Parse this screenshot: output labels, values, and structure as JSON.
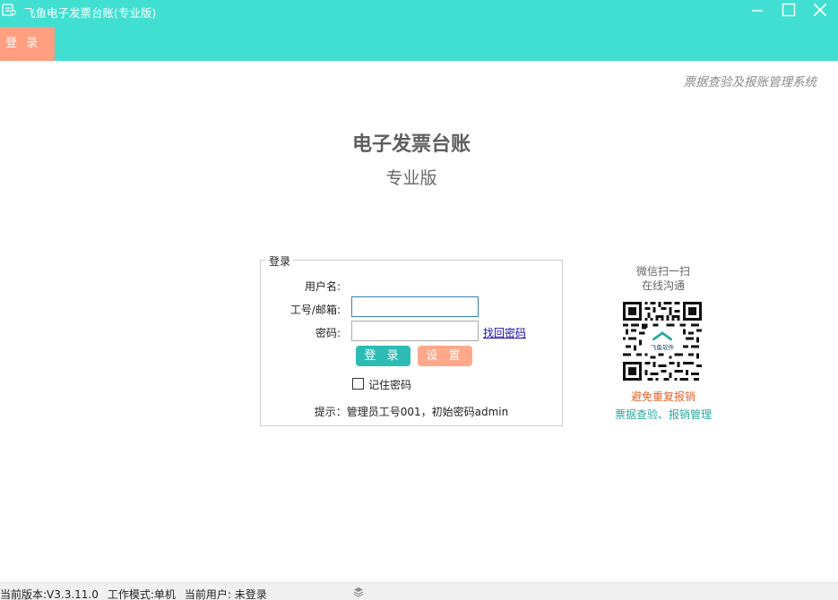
{
  "window": {
    "title": "飞鱼电子发票台账(专业版)",
    "controls": {
      "minimize_icon": "minimize-icon",
      "maximize_icon": "maximize-icon",
      "close_icon": "close-icon"
    }
  },
  "nav": {
    "login_tab": "登 录"
  },
  "header": {
    "slogan": "票据查验及报账管理系统"
  },
  "branding": {
    "main_title": "电子发票台账",
    "edition": "专业版"
  },
  "login": {
    "legend": "登录",
    "username_label": "用户名:",
    "id_email_label": "工号/邮箱:",
    "id_email_value": "",
    "password_label": "密码:",
    "password_value": "",
    "forgot_link": "找回密码",
    "login_button": "登 录",
    "settings_button": "设 置",
    "remember_label": "记住密码",
    "remember_checked": false,
    "hint": "提示：管理员工号001，初始密码admin"
  },
  "qr": {
    "line1": "微信扫一扫",
    "line2": "在线沟通",
    "center_logo_text": "飞鱼软件",
    "tagline_red": "避免重复报销",
    "tagline_teal": "票据查验、报销管理"
  },
  "status": {
    "version": "当前版本:V3.3.11.0",
    "mode": "工作模式:单机",
    "user": "当前用户:  未登录"
  },
  "colors": {
    "titlebar": "#41dfd1",
    "login_tab": "#ff9e80",
    "login_button": "#2cbcb4",
    "settings_button": "#ffa88a",
    "tagline_red": "#e0652b",
    "tagline_teal": "#2aa6a0"
  }
}
